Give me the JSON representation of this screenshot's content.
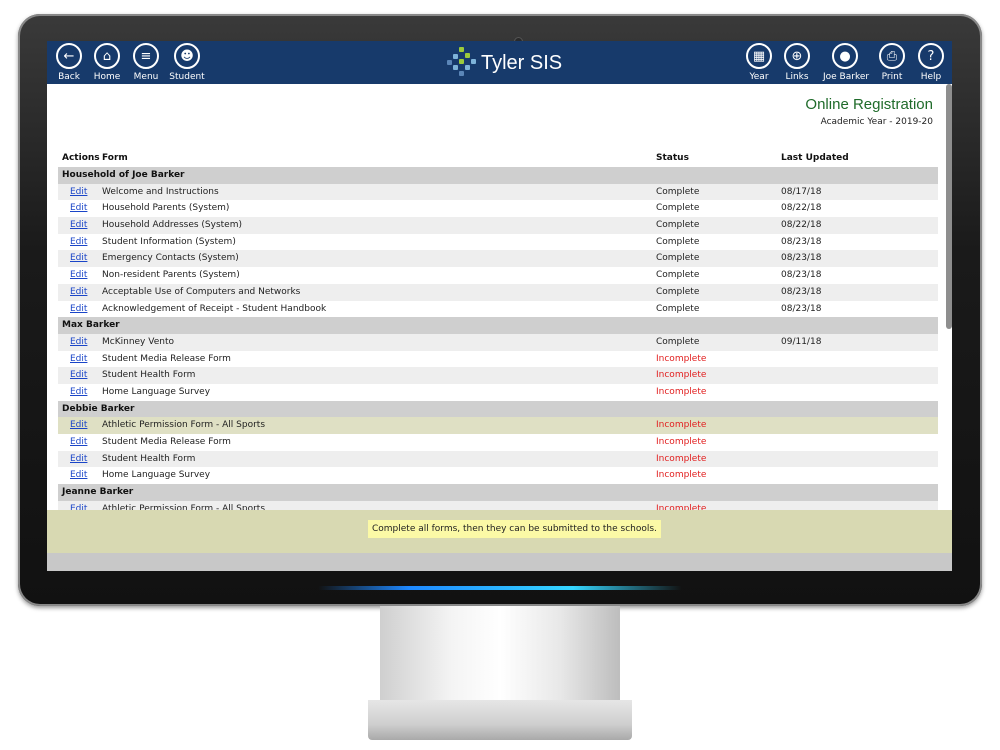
{
  "nav": {
    "left": [
      {
        "label": "Back",
        "icon": "arrow-left-icon",
        "glyph": "←"
      },
      {
        "label": "Home",
        "icon": "home-icon",
        "glyph": "⌂"
      },
      {
        "label": "Menu",
        "icon": "menu-icon",
        "glyph": "≡"
      },
      {
        "label": "Student",
        "icon": "student-icon",
        "glyph": "☻"
      }
    ],
    "brand": "Tyler SIS",
    "right": [
      {
        "label": "Year",
        "icon": "calendar-icon",
        "glyph": "▦"
      },
      {
        "label": "Links",
        "icon": "globe-icon",
        "glyph": "⊕"
      },
      {
        "label": "Joe Barker",
        "icon": "user-icon",
        "glyph": "●"
      },
      {
        "label": "Print",
        "icon": "printer-icon",
        "glyph": "⎙"
      },
      {
        "label": "Help",
        "icon": "help-icon",
        "glyph": "?"
      }
    ]
  },
  "page": {
    "title": "Online Registration",
    "subtitle": "Academic Year - 2019-20"
  },
  "table": {
    "headers": {
      "actions": "Actions",
      "form": "Form",
      "status": "Status",
      "updated": "Last Updated"
    },
    "groups": [
      {
        "name": "Household of Joe Barker",
        "rows": [
          {
            "action": "Edit",
            "form": "Welcome and Instructions",
            "status": "Complete",
            "date": "08/17/18"
          },
          {
            "action": "Edit",
            "form": "Household Parents (System)",
            "status": "Complete",
            "date": "08/22/18"
          },
          {
            "action": "Edit",
            "form": "Household Addresses (System)",
            "status": "Complete",
            "date": "08/22/18"
          },
          {
            "action": "Edit",
            "form": "Student Information (System)",
            "status": "Complete",
            "date": "08/23/18"
          },
          {
            "action": "Edit",
            "form": "Emergency Contacts (System)",
            "status": "Complete",
            "date": "08/23/18"
          },
          {
            "action": "Edit",
            "form": "Non-resident Parents (System)",
            "status": "Complete",
            "date": "08/23/18"
          },
          {
            "action": "Edit",
            "form": "Acceptable Use of Computers and Networks",
            "status": "Complete",
            "date": "08/23/18"
          },
          {
            "action": "Edit",
            "form": "Acknowledgement of Receipt - Student Handbook",
            "status": "Complete",
            "date": "08/23/18"
          }
        ]
      },
      {
        "name": "Max Barker",
        "rows": [
          {
            "action": "Edit",
            "form": "McKinney Vento",
            "status": "Complete",
            "date": "09/11/18"
          },
          {
            "action": "Edit",
            "form": "Student Media Release Form",
            "status": "Incomplete",
            "date": ""
          },
          {
            "action": "Edit",
            "form": "Student Health Form",
            "status": "Incomplete",
            "date": ""
          },
          {
            "action": "Edit",
            "form": "Home Language Survey",
            "status": "Incomplete",
            "date": ""
          }
        ]
      },
      {
        "name": "Debbie Barker",
        "rows": [
          {
            "action": "Edit",
            "form": "Athletic Permission Form - All Sports",
            "status": "Incomplete",
            "date": "",
            "highlight": true
          },
          {
            "action": "Edit",
            "form": "Student Media Release Form",
            "status": "Incomplete",
            "date": ""
          },
          {
            "action": "Edit",
            "form": "Student Health Form",
            "status": "Incomplete",
            "date": ""
          },
          {
            "action": "Edit",
            "form": "Home Language Survey",
            "status": "Incomplete",
            "date": ""
          }
        ]
      },
      {
        "name": "Jeanne Barker",
        "rows": [
          {
            "action": "Edit",
            "form": "Athletic Permission Form - All Sports",
            "status": "Incomplete",
            "date": ""
          }
        ]
      }
    ]
  },
  "footer": {
    "message": "Complete all forms, then they can be submitted to the schools."
  },
  "colors": {
    "topbar": "#173a6b",
    "title": "#1f6b2a",
    "incomplete": "#e22020",
    "link": "#1a45c8",
    "footer": "#d8d9b2"
  }
}
